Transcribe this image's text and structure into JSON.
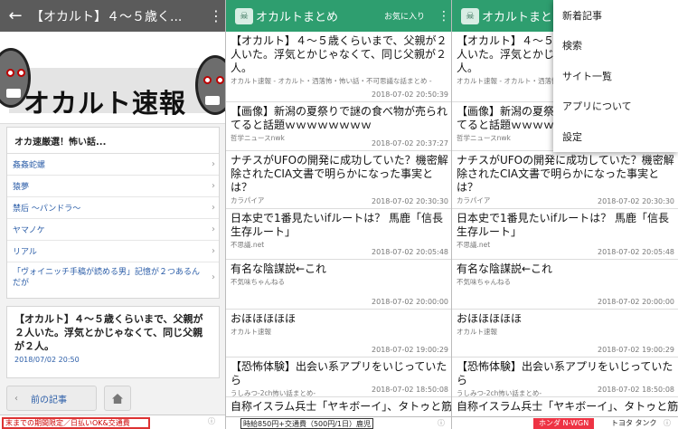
{
  "article_view": {
    "title": "【オカルト】４〜５歳く...",
    "back_icon": "arrow-left-icon",
    "more_icon": "more-vertical-icon",
    "banner_text": "オカルト速報",
    "section_heading": "オカ速厳選！怖い話...",
    "links": [
      {
        "label": "姦姦蛇螺"
      },
      {
        "label": "猿夢"
      },
      {
        "label": "禁后 〜パンドラ〜"
      },
      {
        "label": "ヤマノケ"
      },
      {
        "label": "リアル"
      },
      {
        "label": "「ヴォイニッチ手稿が読める男」記憶が２つあるんだが"
      }
    ],
    "post_title": "【オカルト】４〜５歳くらいまで、父親が２人いた。浮気とかじゃなくて、同じ父親が２人。",
    "post_date": "2018/07/02 20:50",
    "prev_button": "前の記事",
    "home_icon": "home-icon",
    "ad_text": "末までの期間限定／日払いOK&交通費"
  },
  "list_view": {
    "app_title": "オカルトまとめ",
    "favorites_label": "お気に入り",
    "items": [
      {
        "title": "【オカルト】４〜５歳くらいまで、父親が２人いた。浮気とかじゃなくて、同じ父親が２人。",
        "source": "オカルト速報 - オカルト・洒落怖・怖い話・不可思議な話まとめ -",
        "date": "2018-07-02 20:50:39"
      },
      {
        "title": "【画像】新潟の夏祭りで謎の食べ物が売られてると話題ｗｗｗｗｗｗｗｗ",
        "source": "哲学ニュースnwk",
        "date": "2018-07-02 20:37:27"
      },
      {
        "title": "ナチスがUFOの開発に成功していた？機密解除されたCIA文書で明らかになった事実とは？",
        "source": "カラパイア",
        "date": "2018-07-02 20:30:30"
      },
      {
        "title": "日本史で1番見たいifルートは？ 馬鹿「信長生存ルート」",
        "source": "不思議.net",
        "date": "2018-07-02 20:05:48"
      },
      {
        "title": "有名な陰謀説←これ",
        "source": "不気味ちゃんねる",
        "date": "2018-07-02 20:00:00"
      },
      {
        "title": "おほほほほほ",
        "source": "オカルト速報",
        "date": "2018-07-02 19:00:29"
      },
      {
        "title": "【恐怖体験】出会い系アプリをいじっていたら",
        "source": "うしみつ-2ch怖い話まとめ-",
        "date": "2018-07-02 18:50:08"
      },
      {
        "title": "自称イスラム兵士「ヤキボーイ」、タトゥと筋",
        "source": "",
        "date": ""
      }
    ],
    "ad_left_text": "時給850円+交通費（500円/1日）鹿児",
    "ad_right_tag": "ホンダ N-WGN",
    "ad_right_text": "トヨタ タンク"
  },
  "overflow_menu": {
    "items": [
      "新着記事",
      "検索",
      "サイト一覧",
      "アプリについて",
      "設定"
    ]
  },
  "colors": {
    "list_toolbar": "#2e9e6f",
    "article_toolbar": "#5b5b5b",
    "link_text": "#2c5ea8"
  }
}
